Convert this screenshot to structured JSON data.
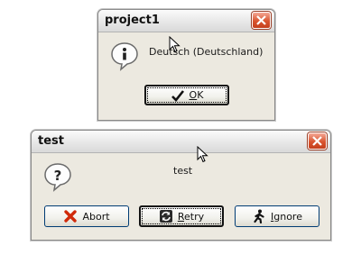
{
  "dialog1": {
    "title": "project1",
    "message": "Deutsch (Deutschland)",
    "icon": "info-speech-bubble-icon",
    "ok_button": {
      "accel": "O",
      "rest": "K"
    }
  },
  "dialog2": {
    "title": "test",
    "message": "test",
    "icon": "question-speech-bubble-icon",
    "abort_button": {
      "label": "Abort"
    },
    "retry_button": {
      "accel": "R",
      "rest": "etry"
    },
    "ignore_button": {
      "accel": "I",
      "rest": "gnore"
    }
  },
  "colors": {
    "close": "#d9542f",
    "abort_x": "#d02a0a",
    "focus_border": "#003c74"
  }
}
